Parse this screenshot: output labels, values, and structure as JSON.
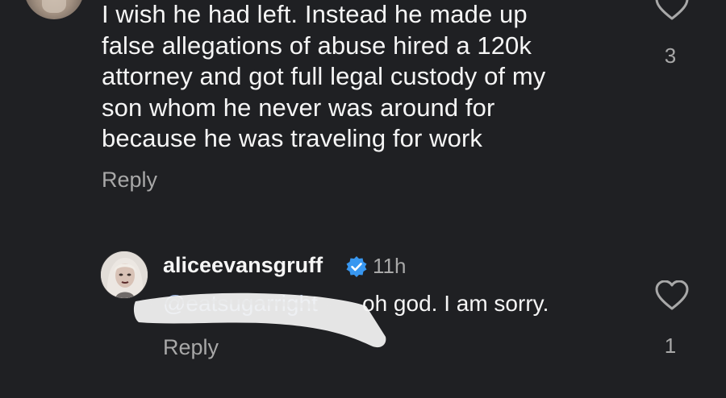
{
  "colors": {
    "background": "#1f2023",
    "text": "#f5f5f5",
    "muted": "#a8a8a8",
    "verified": "#3897f0",
    "mention": "#9ab1d8"
  },
  "comment1": {
    "lines": [
      "I wish he had left. Instead he made up",
      "false allegations of abuse hired a 120k",
      "attorney and got full legal custody of my",
      "son whom he never was around for",
      "because he was traveling for work"
    ],
    "reply_label": "Reply",
    "like_icon": "heart-outline-icon",
    "likes": "3"
  },
  "comment2": {
    "username": "aliceevansgruff",
    "verified_icon": "verified-badge-icon",
    "time": "11h",
    "mention": "@eatsugarright",
    "text": "oh god. I am sorry.",
    "reply_label": "Reply",
    "like_icon": "heart-outline-icon",
    "likes": "1"
  }
}
